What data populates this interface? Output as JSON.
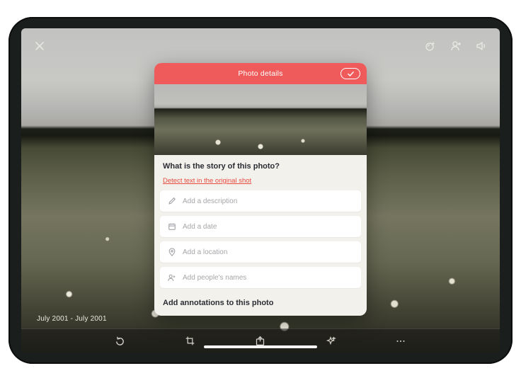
{
  "colors": {
    "accent": "#ef5b5b",
    "link": "#e74a3e"
  },
  "caption": "July 2001 - July 2001",
  "modal": {
    "title": "Photo details",
    "question": "What is the story of this photo?",
    "detect_link": "Detect text in the original shot",
    "annotations_heading": "Add annotations to this photo",
    "fields": {
      "description": "Add a description",
      "date": "Add a date",
      "location": "Add a location",
      "people": "Add people's names"
    }
  }
}
